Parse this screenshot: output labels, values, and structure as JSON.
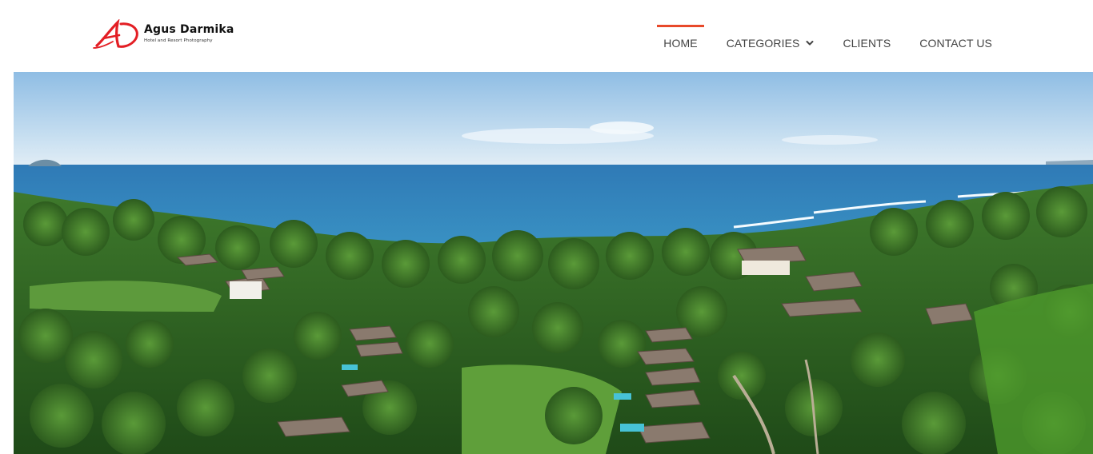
{
  "brand": {
    "monogram": "AD",
    "name": "Agus Darmika",
    "tagline": "Hotel and Resort Photography",
    "accent_color": "#e31e24"
  },
  "nav": {
    "items": [
      {
        "label": "HOME",
        "active": true
      },
      {
        "label": "CATEGORIES",
        "has_dropdown": true,
        "icon": "chevron-down-icon"
      },
      {
        "label": "CLIENTS"
      },
      {
        "label": "CONTACT US"
      }
    ],
    "active_indicator_color": "#e8492a"
  },
  "hero": {
    "image": "aerial view of a tropical beach resort with palm trees and ocean"
  }
}
